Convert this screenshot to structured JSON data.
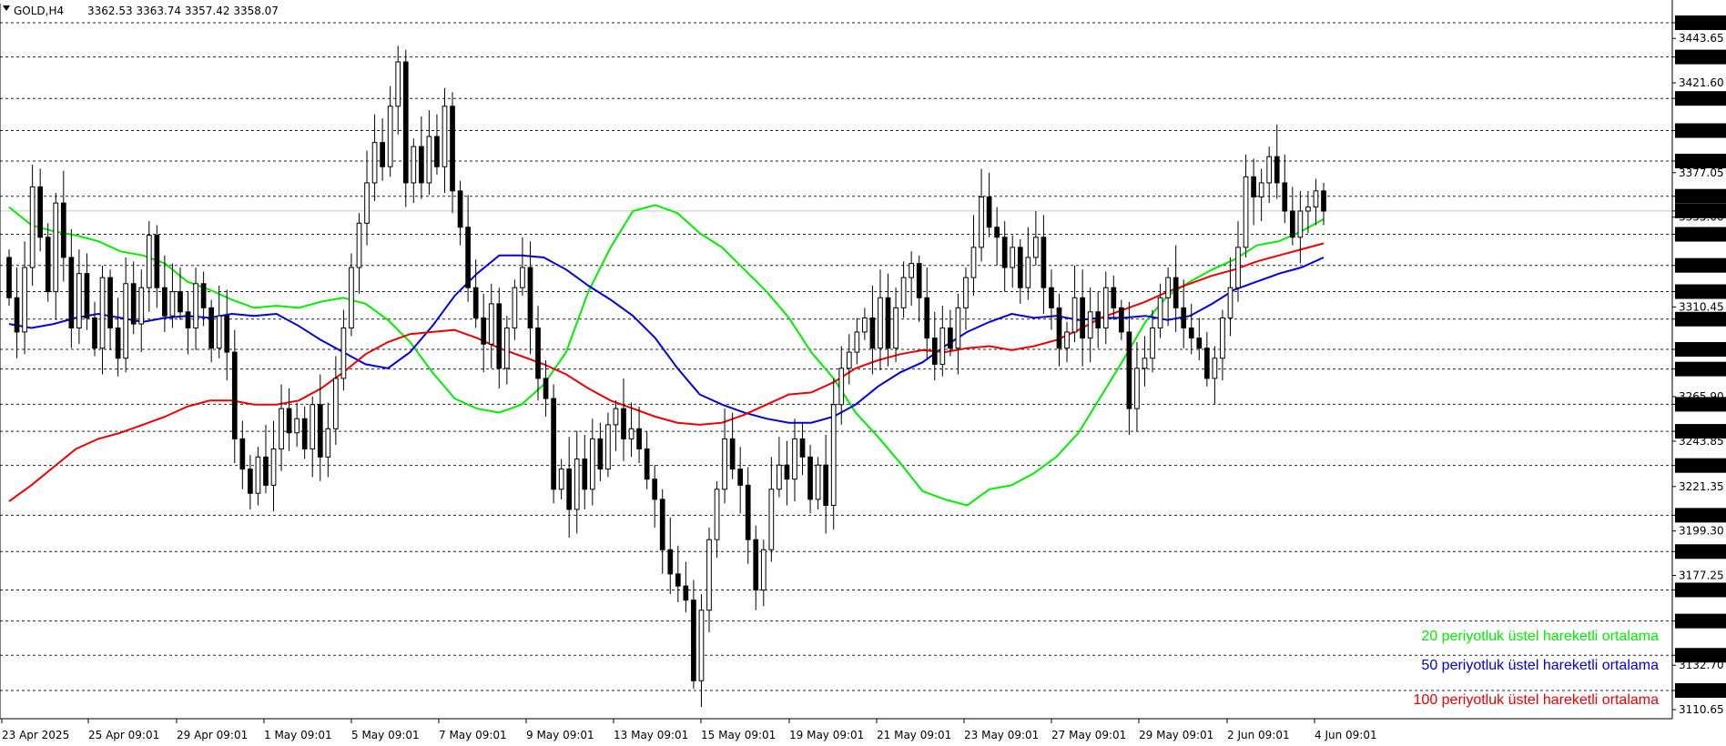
{
  "header": {
    "symbol": "GOLD,H4",
    "ohlc": "3362.53 3363.74 3357.42 3358.07"
  },
  "chart_data": {
    "type": "candlestick",
    "symbol": "GOLD",
    "timeframe": "H4",
    "ylim": [
      3104,
      3458
    ],
    "current_price": 3358.07,
    "marked_levels": [
      3451.42,
      3434.44,
      3413.87,
      3397.92,
      3382.83,
      3365.35,
      3358.07,
      3346.48,
      3331.05,
      3318.04,
      3304.4,
      3289.39,
      3279.62,
      3262.13,
      3248.75,
      3231.78,
      3207.09,
      3189.09,
      3170.05,
      3154.62,
      3137.65,
      3120.16
    ],
    "y_tick_labels": [
      "3443.65",
      "3421.60",
      "3377.05",
      "3355.00",
      "3310.45",
      "3265.90",
      "3243.85",
      "3221.35",
      "3199.30",
      "3177.25",
      "3132.70",
      "3110.65"
    ],
    "x_tick_labels": [
      "23 Apr 2025",
      "25 Apr 09:01",
      "29 Apr 09:01",
      "1 May 09:01",
      "5 May 09:01",
      "7 May 09:01",
      "9 May 09:01",
      "13 May 09:01",
      "15 May 09:01",
      "19 May 09:01",
      "21 May 09:01",
      "23 May 09:01",
      "27 May 09:01",
      "29 May 09:01",
      "2 Jun 09:01",
      "4 Jun 09:01"
    ],
    "grid": true,
    "legend_position": "bottom-right",
    "closes": [
      3315,
      3298,
      3330,
      3370,
      3345,
      3318,
      3362,
      3335,
      3300,
      3327,
      3305,
      3290,
      3325,
      3300,
      3285,
      3322,
      3302,
      3320,
      3346,
      3320,
      3306,
      3318,
      3308,
      3300,
      3322,
      3310,
      3290,
      3306,
      3288,
      3245,
      3230,
      3218,
      3236,
      3222,
      3240,
      3260,
      3248,
      3255,
      3240,
      3262,
      3236,
      3250,
      3275,
      3300,
      3330,
      3352,
      3372,
      3392,
      3380,
      3410,
      3432,
      3372,
      3390,
      3372,
      3395,
      3380,
      3410,
      3368,
      3350,
      3320,
      3305,
      3292,
      3312,
      3280,
      3300,
      3320,
      3330,
      3300,
      3275,
      3265,
      3220,
      3230,
      3210,
      3235,
      3220,
      3245,
      3230,
      3252,
      3260,
      3245,
      3250,
      3240,
      3225,
      3215,
      3190,
      3178,
      3172,
      3165,
      3125,
      3160,
      3195,
      3220,
      3245,
      3230,
      3222,
      3195,
      3170,
      3190,
      3220,
      3232,
      3225,
      3245,
      3236,
      3215,
      3232,
      3212,
      3262,
      3280,
      3288,
      3298,
      3305,
      3290,
      3315,
      3290,
      3310,
      3325,
      3332,
      3315,
      3295,
      3282,
      3300,
      3290,
      3310,
      3325,
      3340,
      3365,
      3350,
      3345,
      3330,
      3340,
      3320,
      3335,
      3345,
      3320,
      3310,
      3290,
      3298,
      3315,
      3295,
      3308,
      3300,
      3320,
      3310,
      3298,
      3260,
      3280,
      3285,
      3300,
      3315,
      3325,
      3310,
      3300,
      3295,
      3290,
      3275,
      3285,
      3305,
      3320,
      3340,
      3375,
      3365,
      3372,
      3385,
      3372,
      3358,
      3345,
      3358,
      3360,
      3368,
      3358
    ],
    "series": [
      {
        "name": "20 periyotluk üstel hareketli ortalama",
        "color": "#00ee00",
        "values": [
          3360,
          3351,
          3348,
          3346,
          3343,
          3338,
          3336,
          3332,
          3323,
          3319,
          3314,
          3310,
          3311,
          3310,
          3313,
          3315,
          3312,
          3304,
          3293,
          3278,
          3265,
          3260,
          3258,
          3262,
          3272,
          3288,
          3318,
          3340,
          3358,
          3361,
          3357,
          3347,
          3340,
          3329,
          3318,
          3305,
          3288,
          3275,
          3258,
          3246,
          3233,
          3219,
          3215,
          3212,
          3220,
          3222,
          3228,
          3236,
          3248,
          3266,
          3284,
          3303,
          3316,
          3323,
          3329,
          3334,
          3341,
          3343,
          3348,
          3354
        ]
      },
      {
        "name": "50 periyotluk üstel hareketli ortalama",
        "color": "#0000dd",
        "values": [
          3302,
          3300,
          3302,
          3305,
          3307,
          3305,
          3303,
          3305,
          3306,
          3305,
          3307,
          3306,
          3307,
          3301,
          3294,
          3288,
          3282,
          3280,
          3288,
          3301,
          3316,
          3327,
          3336,
          3336,
          3335,
          3329,
          3321,
          3314,
          3306,
          3295,
          3280,
          3267,
          3262,
          3258,
          3255,
          3253,
          3253,
          3256,
          3262,
          3271,
          3278,
          3283,
          3291,
          3298,
          3303,
          3307,
          3305,
          3306,
          3304,
          3305,
          3305,
          3306,
          3304,
          3306,
          3312,
          3319,
          3323,
          3327,
          3330,
          3335
        ]
      },
      {
        "name": "100 periyotluk üstel hareketli ortalama",
        "color": "#ee0000",
        "values": [
          3214,
          3222,
          3231,
          3240,
          3245,
          3248,
          3252,
          3256,
          3261,
          3264,
          3264,
          3262,
          3262,
          3264,
          3270,
          3278,
          3287,
          3293,
          3297,
          3298,
          3299,
          3295,
          3290,
          3286,
          3282,
          3277,
          3270,
          3264,
          3260,
          3256,
          3253,
          3252,
          3253,
          3257,
          3262,
          3267,
          3268,
          3273,
          3280,
          3284,
          3287,
          3289,
          3288,
          3290,
          3291,
          3289,
          3291,
          3294,
          3299,
          3305,
          3309,
          3313,
          3318,
          3322,
          3326,
          3329,
          3333,
          3336,
          3339,
          3342
        ]
      }
    ]
  },
  "legend": {
    "ema20": "20 periyotluk üstel hareketli ortalama",
    "ema50": "50 periyotluk üstel hareketli ortalama",
    "ema100": "100 periyotluk üstel hareketli ortalama"
  },
  "colors": {
    "ema20": "#00ee00",
    "ema50": "#0000dd",
    "ema100": "#ee0000",
    "candle_up": "#ffffff",
    "candle_down": "#000000",
    "grid": "#222222"
  }
}
